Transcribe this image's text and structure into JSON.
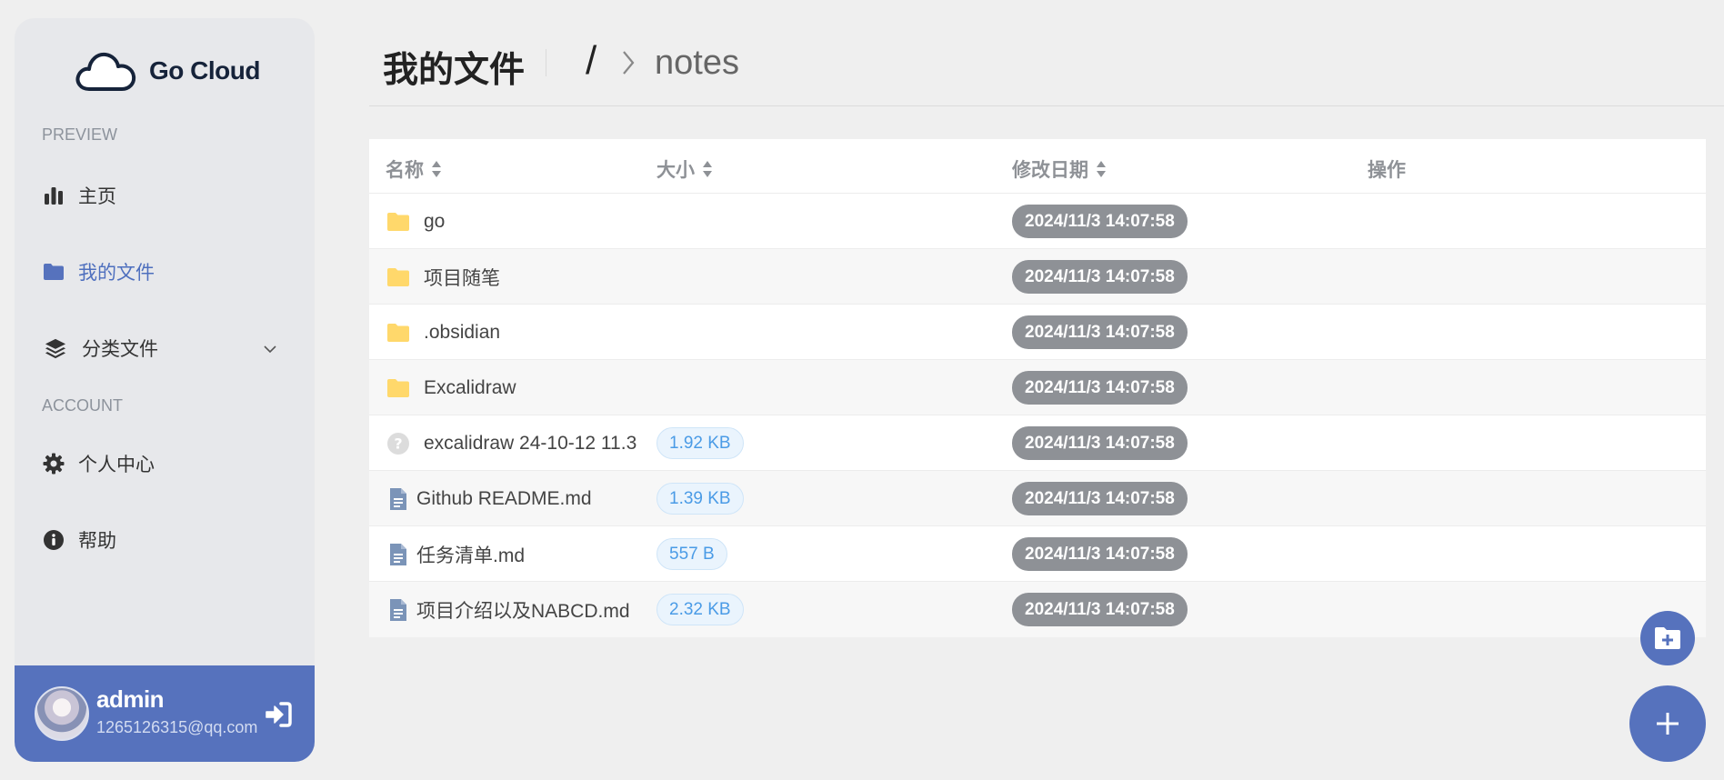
{
  "app": {
    "logo_text": "Go Cloud"
  },
  "sidebar": {
    "sections": [
      {
        "label": "PREVIEW"
      },
      {
        "label": "ACCOUNT"
      }
    ],
    "items": [
      {
        "label": "主页",
        "icon": "bar-chart-icon"
      },
      {
        "label": "我的文件",
        "icon": "folder-icon",
        "active": true
      },
      {
        "label": "分类文件",
        "icon": "layers-icon",
        "expandable": true
      },
      {
        "label": "个人中心",
        "icon": "gear-icon"
      },
      {
        "label": "帮助",
        "icon": "info-icon"
      }
    ]
  },
  "user": {
    "name": "admin",
    "email": "1265126315@qq.com"
  },
  "header": {
    "title": "我的文件",
    "breadcrumb_root": "/",
    "breadcrumb_current": "notes"
  },
  "table": {
    "columns": [
      "名称",
      "大小",
      "修改日期",
      "操作"
    ],
    "rows": [
      {
        "name": "go",
        "type": "folder",
        "size": "",
        "date": "2024/11/3 14:07:58"
      },
      {
        "name": "项目随笔",
        "type": "folder",
        "size": "",
        "date": "2024/11/3 14:07:58"
      },
      {
        "name": ".obsidian",
        "type": "folder",
        "size": "",
        "date": "2024/11/3 14:07:58"
      },
      {
        "name": "Excalidraw",
        "type": "folder",
        "size": "",
        "date": "2024/11/3 14:07:58"
      },
      {
        "name": "excalidraw 24-10-12 11.3",
        "type": "unknown",
        "size": "1.92 KB",
        "date": "2024/11/3 14:07:58"
      },
      {
        "name": "Github README.md",
        "type": "document",
        "size": "1.39 KB",
        "date": "2024/11/3 14:07:58"
      },
      {
        "name": "任务清单.md",
        "type": "document",
        "size": "557 B",
        "date": "2024/11/3 14:07:58"
      },
      {
        "name": "项目介绍以及NABCD.md",
        "type": "document",
        "size": "2.32 KB",
        "date": "2024/11/3 14:07:58"
      }
    ]
  },
  "colors": {
    "accent": "#5672bd",
    "active_text": "#4e6fbe",
    "folder": "#ffd86b",
    "date_tag": "#8e9196"
  }
}
